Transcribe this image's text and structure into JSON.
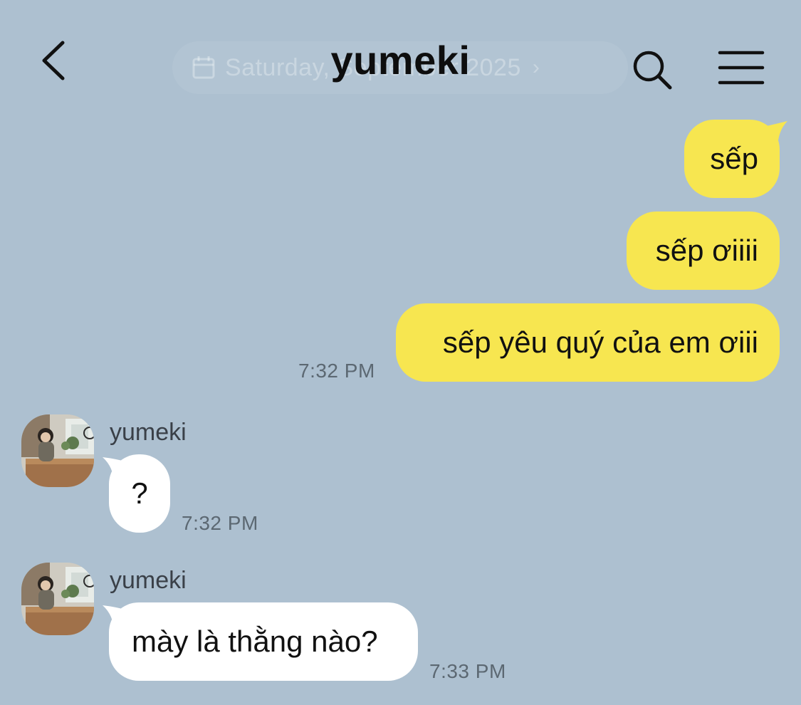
{
  "header": {
    "title": "yumeki",
    "date_pill": {
      "text": "Saturday, September 2025",
      "icon": "calendar-icon"
    },
    "back_icon": "chevron-left-icon",
    "search_icon": "search-icon",
    "menu_icon": "hamburger-menu-icon"
  },
  "messages": {
    "sent": [
      {
        "text": "sếp"
      },
      {
        "text": "sếp ơiiii"
      },
      {
        "text": "sếp yêu quý của em ơiii",
        "time": "7:32 PM"
      }
    ],
    "received": [
      {
        "sender": "yumeki",
        "text": "?",
        "time": "7:32 PM"
      },
      {
        "sender": "yumeki",
        "text": "mày là thằng nào?",
        "time": "7:33 PM"
      }
    ]
  },
  "colors": {
    "background": "#adc0d0",
    "sent_bubble": "#f7e650",
    "received_bubble": "#ffffff",
    "timestamp": "#5c6872"
  }
}
